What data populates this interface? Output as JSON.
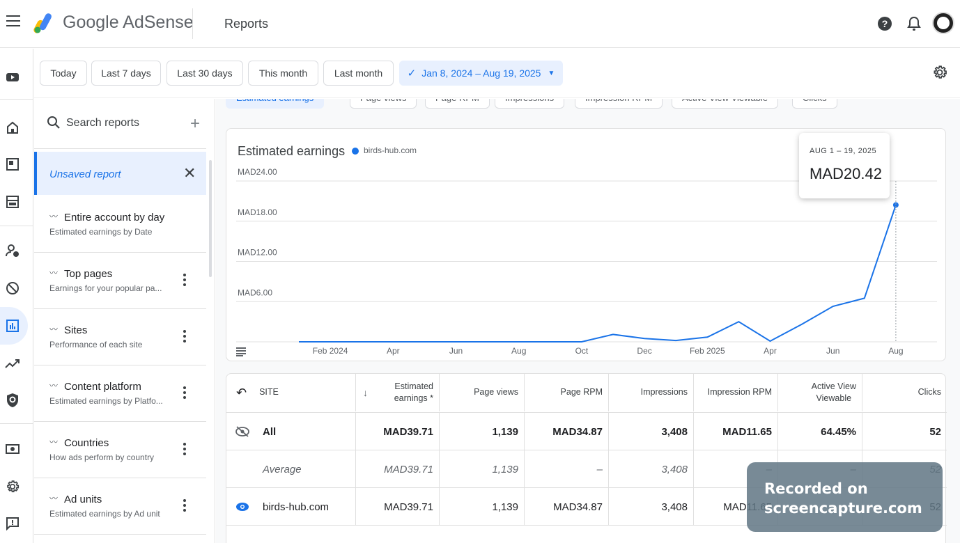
{
  "header": {
    "brand": "Google AdSense",
    "page_title": "Reports"
  },
  "date_filters": {
    "today": "Today",
    "last7": "Last 7 days",
    "last30": "Last 30 days",
    "this_month": "This month",
    "last_month": "Last month",
    "selected_range": "Jan 8, 2024 – Aug 19, 2025"
  },
  "sidebar": {
    "search_placeholder": "Search reports",
    "unsaved": "Unsaved report",
    "reports": [
      {
        "title": "Entire account by day",
        "subtitle": "Estimated earnings by Date"
      },
      {
        "title": "Top pages",
        "subtitle": "Earnings for your popular pa..."
      },
      {
        "title": "Sites",
        "subtitle": "Performance of each site"
      },
      {
        "title": "Content platform",
        "subtitle": "Estimated earnings by Platfo..."
      },
      {
        "title": "Countries",
        "subtitle": "How ads perform by country"
      },
      {
        "title": "Ad units",
        "subtitle": "Estimated earnings by Ad unit"
      }
    ]
  },
  "metrics": [
    "Estimated earnings",
    "Page views",
    "Page RPM",
    "Impressions",
    "Impression RPM",
    "Active View Viewable",
    "Clicks"
  ],
  "chart": {
    "title": "Estimated earnings",
    "legend": "birds-hub.com",
    "tooltip_date": "AUG 1 – 19, 2025",
    "tooltip_value": "MAD20.42"
  },
  "chart_data": {
    "type": "line",
    "title": "Estimated earnings",
    "series": [
      {
        "name": "birds-hub.com",
        "color": "#1a73e8",
        "points": [
          {
            "x": "2024-01",
            "y": 0
          },
          {
            "x": "2024-02",
            "y": 0
          },
          {
            "x": "2024-03",
            "y": 0
          },
          {
            "x": "2024-04",
            "y": 0
          },
          {
            "x": "2024-05",
            "y": 0
          },
          {
            "x": "2024-06",
            "y": 0
          },
          {
            "x": "2024-07",
            "y": 0
          },
          {
            "x": "2024-08",
            "y": 0
          },
          {
            "x": "2024-09",
            "y": 0
          },
          {
            "x": "2024-10",
            "y": 0
          },
          {
            "x": "2024-11",
            "y": 1.1
          },
          {
            "x": "2024-12",
            "y": 0.5
          },
          {
            "x": "2025-01",
            "y": 0.2
          },
          {
            "x": "2025-02",
            "y": 0.7
          },
          {
            "x": "2025-03",
            "y": 3.0
          },
          {
            "x": "2025-04",
            "y": 0.1
          },
          {
            "x": "2025-05",
            "y": 2.6
          },
          {
            "x": "2025-06",
            "y": 5.3
          },
          {
            "x": "2025-07",
            "y": 6.5
          },
          {
            "x": "2025-08",
            "y": 20.42
          }
        ]
      }
    ],
    "x_ticks": [
      "Feb 2024",
      "Apr",
      "Jun",
      "Aug",
      "Oct",
      "Dec",
      "Feb 2025",
      "Apr",
      "Jun",
      "Aug"
    ],
    "y_ticks": [
      "MAD6.00",
      "MAD12.00",
      "MAD18.00",
      "MAD24.00"
    ],
    "ylim": [
      0,
      24
    ],
    "grid": true
  },
  "table": {
    "headers": {
      "site": "SITE",
      "est_earnings_1": "Estimated",
      "est_earnings_2": "earnings *",
      "page_views": "Page views",
      "page_rpm": "Page RPM",
      "impressions": "Impressions",
      "impression_rpm": "Impression RPM",
      "active_view_1": "Active View",
      "active_view_2": "Viewable",
      "clicks": "Clicks"
    },
    "rows": [
      {
        "site": "All",
        "earn": "MAD39.71",
        "pv": "1,139",
        "prpm": "MAD34.87",
        "imp": "3,408",
        "irpm": "MAD11.65",
        "av": "64.45%",
        "clicks": "52"
      },
      {
        "site": "Average",
        "earn": "MAD39.71",
        "pv": "1,139",
        "prpm": "–",
        "imp": "3,408",
        "irpm": "–",
        "av": "–",
        "clicks": "52"
      },
      {
        "site": "birds-hub.com",
        "earn": "MAD39.71",
        "pv": "1,139",
        "prpm": "MAD34.87",
        "imp": "3,408",
        "irpm": "MAD11.65",
        "av": "",
        "clicks": "52"
      }
    ]
  },
  "watermark": {
    "line1": "Recorded on",
    "line2": "screencapture.com"
  }
}
